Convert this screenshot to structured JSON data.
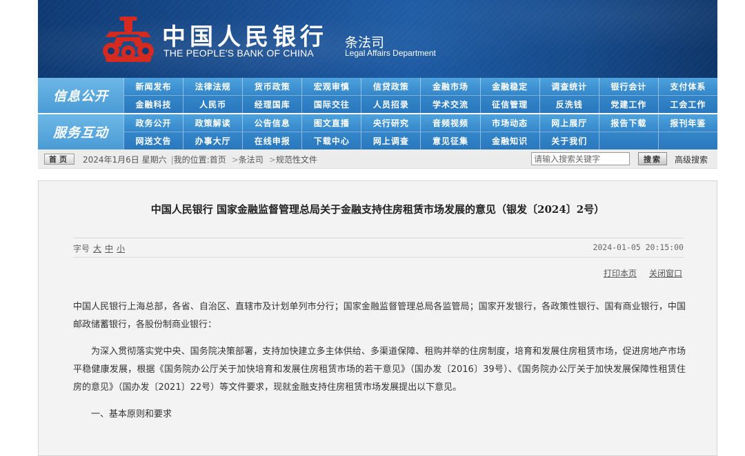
{
  "banner": {
    "bank_cn": "中国人民银行",
    "bank_en": "THE PEOPLE'S BANK OF CHINA",
    "dept_cn": "条法司",
    "dept_en": "Legal Affairs Department",
    "emblem_color": "#d42a20",
    "bg_color": "#1a4f93"
  },
  "nav": {
    "group1": {
      "title": "信息公开",
      "row1": [
        "新闻发布",
        "法律法规",
        "货币政策",
        "宏观审慎",
        "信贷政策",
        "金融市场",
        "金融稳定",
        "调查统计",
        "银行会计",
        "支付体系"
      ],
      "row2": [
        "金融科技",
        "人民币",
        "经理国库",
        "国际交往",
        "人员招录",
        "学术交流",
        "征信管理",
        "反洗钱",
        "党建工作",
        "工会工作"
      ]
    },
    "group2": {
      "title": "服务互动",
      "row1": [
        "政务公开",
        "政策解读",
        "公告信息",
        "图文直播",
        "央行研究",
        "音频视频",
        "市场动态",
        "网上展厅",
        "报告下载",
        "报刊年鉴"
      ],
      "row2": [
        "网送文告",
        "办事大厅",
        "在线申报",
        "下载中心",
        "网上调查",
        "意见征集",
        "金融知识",
        "关于我们",
        "",
        ""
      ]
    }
  },
  "infobar": {
    "home_label": "首页",
    "date": "2024年1月6日 星期六",
    "location_prefix": "我的位置:首页",
    "crumb1": "条法司",
    "crumb2": "规范性文件",
    "search_placeholder": "请输入搜索关键字",
    "search_button": "搜索",
    "advanced_search": "高级搜索"
  },
  "article": {
    "title": "中国人民银行 国家金融监督管理总局关于金融支持住房租赁市场发展的意见（银发〔2024〕2号）",
    "font_size_label": "字号",
    "font_large": "大",
    "font_medium": "中",
    "font_small": "小",
    "date": "2024-01-05 20:15:00",
    "print_label": "打印本页",
    "close_label": "关闭窗口",
    "para1": "中国人民银行上海总部，各省、自治区、直辖市及计划单列市分行；国家金融监督管理总局各监管局；国家开发银行，各政策性银行、国有商业银行，中国邮政储蓄银行，各股份制商业银行：",
    "para2": "为深入贯彻落实党中央、国务院决策部署，支持加快建立多主体供给、多渠道保障、租购并举的住房制度，培育和发展住房租赁市场，促进房地产市场平稳健康发展，根据《国务院办公厅关于加快培育和发展住房租赁市场的若干意见》（国办发〔2016〕39号）、《国务院办公厅关于加快发展保障性租赁住房的意见》（国办发〔2021〕22号）等文件要求，现就金融支持住房租赁市场发展提出以下意见。",
    "section1": "一、基本原则和要求"
  }
}
